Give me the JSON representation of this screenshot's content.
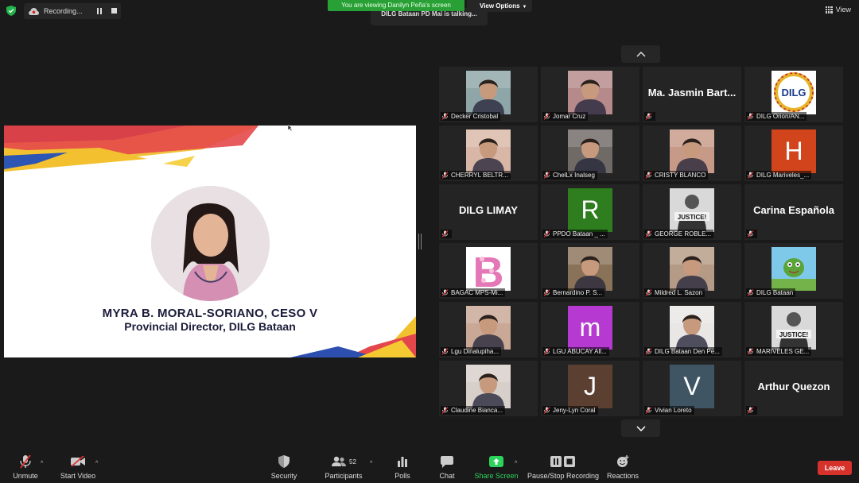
{
  "top": {
    "recording_label": "Recording...",
    "viewing_banner": "You are viewing Danilyn Peña's screen",
    "view_options_label": "View Options",
    "talking_label": "DILG Bataan PD Mai is talking...",
    "view_label": "View"
  },
  "slide": {
    "name": "MYRA B. MORAL-SORIANO, CESO V",
    "title": "Provincial Director, DILG Bataan"
  },
  "participants": [
    {
      "name": "Decker Cristobal",
      "kind": "video",
      "tone": "#8fa6a8"
    },
    {
      "name": "Jomar Cruz",
      "kind": "video",
      "tone": "#b6898a"
    },
    {
      "name": "",
      "display": "Ma. Jasmin Bart...",
      "kind": "name"
    },
    {
      "name": "DILG Orion/AN...",
      "kind": "logo"
    },
    {
      "name": "CHERRYL BELTR...",
      "kind": "video",
      "tone": "#d9b7a7"
    },
    {
      "name": "ChelLx Inalseg",
      "kind": "video",
      "tone": "#6f6a66"
    },
    {
      "name": "CRISTY BLANCO",
      "kind": "video",
      "tone": "#c79a88"
    },
    {
      "name": "DILG Mariveles_...",
      "kind": "letter",
      "letter": "H",
      "color": "#d1441c"
    },
    {
      "name": "",
      "display": "DILG LIMAY",
      "kind": "name"
    },
    {
      "name": "PPDO Bataan _ ...",
      "kind": "letter",
      "letter": "R",
      "color": "#2e7d1e"
    },
    {
      "name": "GEORGE ROBLE...",
      "kind": "justice"
    },
    {
      "name": "",
      "display": "Carina Española",
      "kind": "name"
    },
    {
      "name": "BAGAC MPS-Mi...",
      "kind": "flowerB"
    },
    {
      "name": "Bernardino P. S...",
      "kind": "video",
      "tone": "#8a7258"
    },
    {
      "name": "Mildred L. Sazon",
      "kind": "video",
      "tone": "#b59b86"
    },
    {
      "name": "DILG Bataan",
      "kind": "cartoon"
    },
    {
      "name": "Lgu Dinalupiha...",
      "kind": "video",
      "tone": "#c9a896"
    },
    {
      "name": "LGU ABUCAY All...",
      "kind": "letter",
      "letter": "m",
      "color": "#b63ad1"
    },
    {
      "name": "DILG Bataan Den Pe...",
      "kind": "video",
      "tone": "#e9e7e6"
    },
    {
      "name": "MARIVELES GE...",
      "kind": "justice"
    },
    {
      "name": "Claudine Bianca...",
      "kind": "video",
      "tone": "#d7cfca"
    },
    {
      "name": "Jeny-Lyn Coral",
      "kind": "letter",
      "letter": "J",
      "color": "#5b4032"
    },
    {
      "name": "Vivian Loreto",
      "kind": "letter",
      "letter": "V",
      "color": "#3f5563"
    },
    {
      "name": "",
      "display": "Arthur Quezon",
      "kind": "name"
    }
  ],
  "toolbar": {
    "unmute": "Unmute",
    "start_video": "Start Video",
    "security": "Security",
    "participants": "Participants",
    "participants_count": "52",
    "polls": "Polls",
    "chat": "Chat",
    "share_screen": "Share Screen",
    "pause_stop_recording": "Pause/Stop Recording",
    "reactions": "Reactions",
    "leave": "Leave"
  },
  "colors": {
    "share_green": "#2bd35b",
    "leave_red": "#d6312b",
    "banner_green": "#29a035"
  }
}
